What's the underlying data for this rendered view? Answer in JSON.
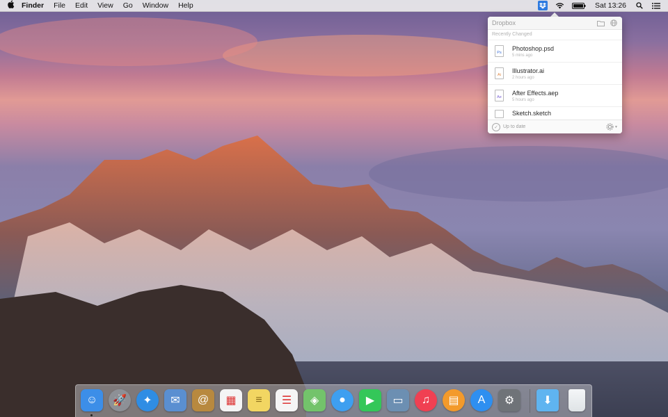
{
  "menubar": {
    "apple_glyph": "",
    "app_name": "Finder",
    "menus": [
      "File",
      "Edit",
      "View",
      "Go",
      "Window",
      "Help"
    ],
    "clock": "Sat 13:26",
    "icons": [
      "dropbox-icon",
      "wifi-icon",
      "battery-icon",
      "spotlight-icon",
      "notification-center-icon"
    ]
  },
  "dropbox": {
    "title": "Dropbox",
    "section_label": "Recently Changed",
    "files": [
      {
        "name": "Photoshop.psd",
        "time": "5 mins ago",
        "badge": "Ps"
      },
      {
        "name": "Illustrator.ai",
        "time": "2 hours ago",
        "badge": "Ai"
      },
      {
        "name": "After Effects.aep",
        "time": "5 hours ago",
        "badge": "Ae"
      },
      {
        "name": "Sketch.sketch",
        "time": "",
        "badge": ""
      }
    ],
    "status": "Up to date",
    "colors": {
      "accent": "#2e7be0",
      "ps": "#3a6fd8",
      "ai": "#e0843a",
      "ae": "#7b62d6"
    }
  },
  "dock": {
    "apps": [
      {
        "name": "finder-icon",
        "glyph": "☺",
        "color": "#3c8ee8"
      },
      {
        "name": "launchpad-icon",
        "glyph": "🚀",
        "color": "#8d9096"
      },
      {
        "name": "safari-icon",
        "glyph": "✦",
        "color": "#2f8de4"
      },
      {
        "name": "mail-icon",
        "glyph": "✉",
        "color": "#5a8fd1"
      },
      {
        "name": "contacts-icon",
        "glyph": "@",
        "color": "#b8893f"
      },
      {
        "name": "calendar-icon",
        "glyph": "▦",
        "color": "#f4f4f4"
      },
      {
        "name": "notes-icon",
        "glyph": "≡",
        "color": "#f2d662"
      },
      {
        "name": "reminders-icon",
        "glyph": "☰",
        "color": "#f5f5f5"
      },
      {
        "name": "maps-icon",
        "glyph": "◈",
        "color": "#73c36b"
      },
      {
        "name": "messages-icon",
        "glyph": "●",
        "color": "#3e9ff0"
      },
      {
        "name": "facetime-icon",
        "glyph": "▶",
        "color": "#34c759"
      },
      {
        "name": "preview-icon",
        "glyph": "▭",
        "color": "#6c8fb2"
      },
      {
        "name": "itunes-icon",
        "glyph": "♫",
        "color": "#f04052"
      },
      {
        "name": "ibooks-icon",
        "glyph": "▤",
        "color": "#f39a2b"
      },
      {
        "name": "app-store-icon",
        "glyph": "A",
        "color": "#2e8ff0"
      },
      {
        "name": "system-preferences-icon",
        "glyph": "⚙",
        "color": "#6f7378"
      }
    ],
    "downloads": {
      "name": "downloads-folder-icon",
      "glyph": "⬇",
      "color": "#5fb4f0"
    },
    "trash": {
      "name": "trash-icon",
      "glyph": "",
      "color": "#dfe3e6"
    }
  }
}
